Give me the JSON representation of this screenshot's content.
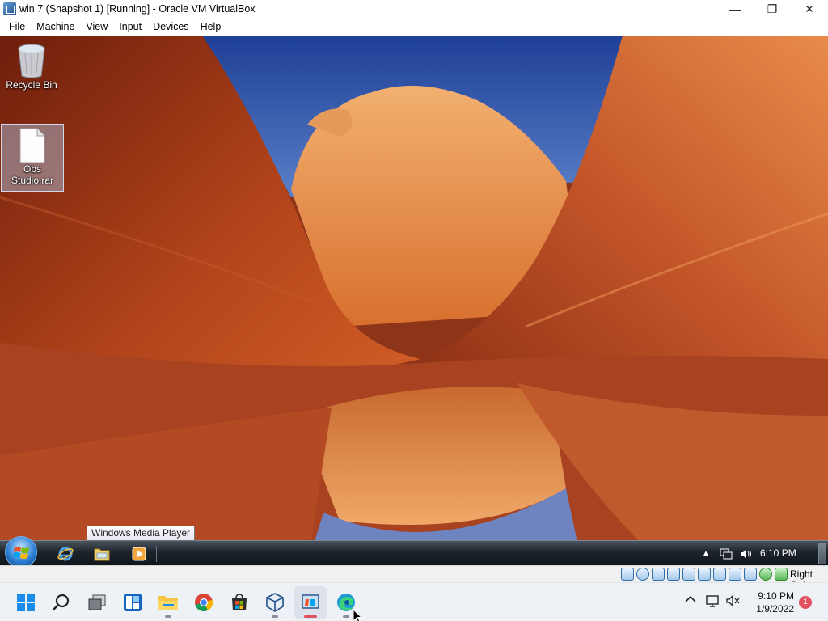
{
  "window": {
    "title": "win 7 (Snapshot 1) [Running] - Oracle VM VirtualBox",
    "icon": "virtualbox-icon",
    "controls": [
      "minimize-icon",
      "maximize-icon",
      "close-icon"
    ]
  },
  "menubar": {
    "items": [
      "File",
      "Machine",
      "View",
      "Input",
      "Devices",
      "Help"
    ]
  },
  "guest": {
    "desktop_icons": [
      {
        "label": "Recycle Bin",
        "icon": "recycle-bin-icon"
      },
      {
        "label": "Obs Studio.rar",
        "icon": "file-icon",
        "selected": true
      }
    ],
    "taskbar": {
      "start": "windows7-start-orb-icon",
      "pinned": [
        "internet-explorer-icon",
        "windows-explorer-icon",
        "windows-media-player-icon"
      ],
      "tray_icons": [
        "show-hidden-icons",
        "network-icon",
        "volume-icon"
      ],
      "clock": "6:10 PM"
    },
    "tooltip": "Windows Media Player"
  },
  "statusbar": {
    "icons": [
      "hard-disk-icon",
      "optical-drive-icon",
      "audio-icon",
      "network-icon",
      "usb-icon",
      "shared-folders-icon",
      "display-icon",
      "video-capture-icon",
      "mouse-integration-icon",
      "cpu-icon",
      "keyboard-icon"
    ],
    "host_key": "Right Ctrl"
  },
  "host_taskbar": {
    "buttons": [
      "windows-start-icon",
      "search-icon",
      "task-view-icon",
      "widgets-icon",
      "file-explorer-icon",
      "chrome-icon",
      "microsoft-store-icon",
      "virtualbox-icon",
      "virtualbox-vm-icon",
      "edge-icon"
    ],
    "tray_icons": [
      "chevron-up-icon",
      "network-icon",
      "mute-icon"
    ],
    "time": "9:10 PM",
    "date": "1/9/2022",
    "notification_count": "1"
  },
  "colors": {
    "wallpaper_sky": "#2c4fa8",
    "rock_orange": "#d86a2c",
    "w11_taskbar": "#eef1f6",
    "w7_taskbar": "#1d242b"
  }
}
